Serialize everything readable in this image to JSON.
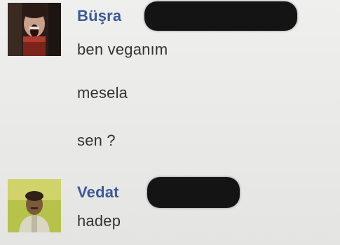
{
  "conversation": {
    "messages": [
      {
        "sender": "Büşra",
        "lines": [
          "ben veganım",
          "mesela",
          "sen ?"
        ]
      },
      {
        "sender": "Vedat",
        "lines": [
          "hadep"
        ]
      }
    ]
  },
  "colors": {
    "background": "#ebebea",
    "sender_name": "#3b5998",
    "message_text": "#333333",
    "redaction": "#141414"
  }
}
